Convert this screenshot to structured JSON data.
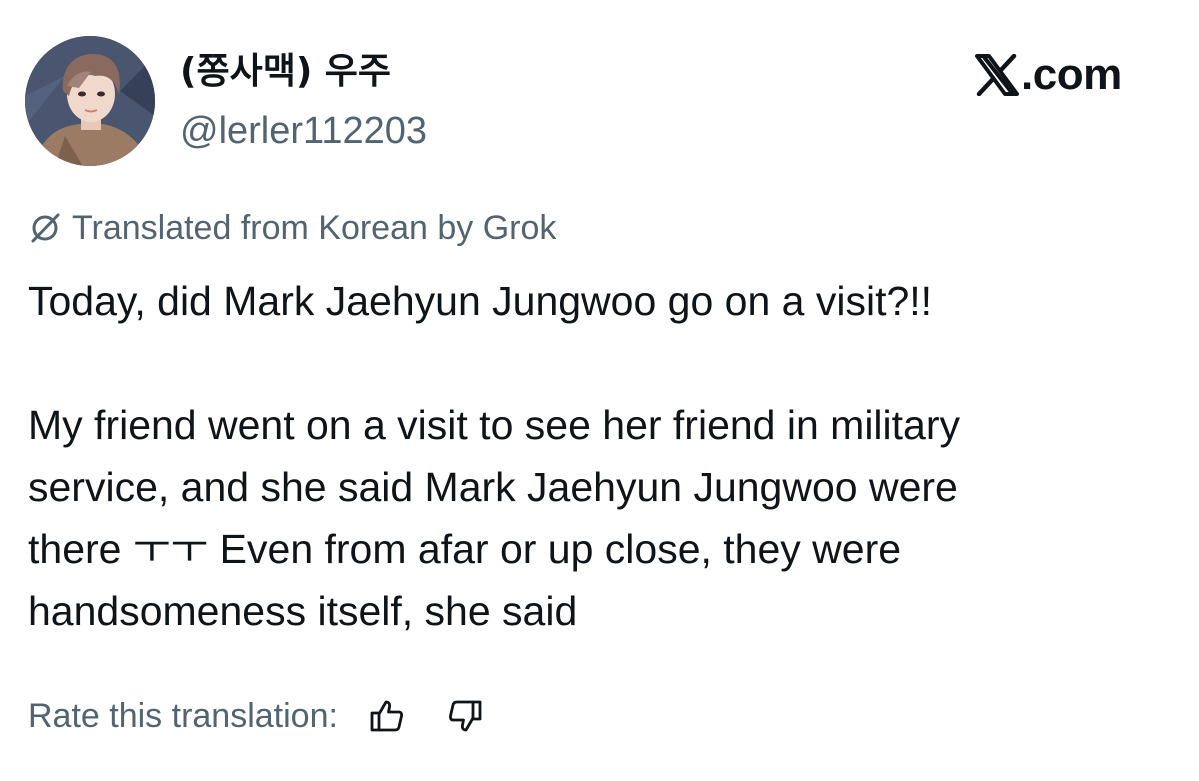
{
  "author": {
    "display_name": "(쫑사맥) 우주",
    "handle": "@lerler112203",
    "avatar_icon": "profile-photo"
  },
  "brand": {
    "suffix": ".com",
    "logo_icon": "x-logo-icon"
  },
  "translation": {
    "notice": "Translated from Korean by Grok",
    "rate_label": "Rate this translation:"
  },
  "tweet": {
    "line1": "Today, did Mark Jaehyun Jungwoo go on a visit?!!",
    "line2": "My friend went on a visit to see her friend in military",
    "line3": "service, and she said Mark Jaehyun Jungwoo were",
    "line4": "there ㅜㅜ Even from afar or up close, they were",
    "line5": "handsomeness itself, she said"
  },
  "colors": {
    "text_primary": "#0f1419",
    "text_secondary": "#536471",
    "background": "#ffffff"
  }
}
